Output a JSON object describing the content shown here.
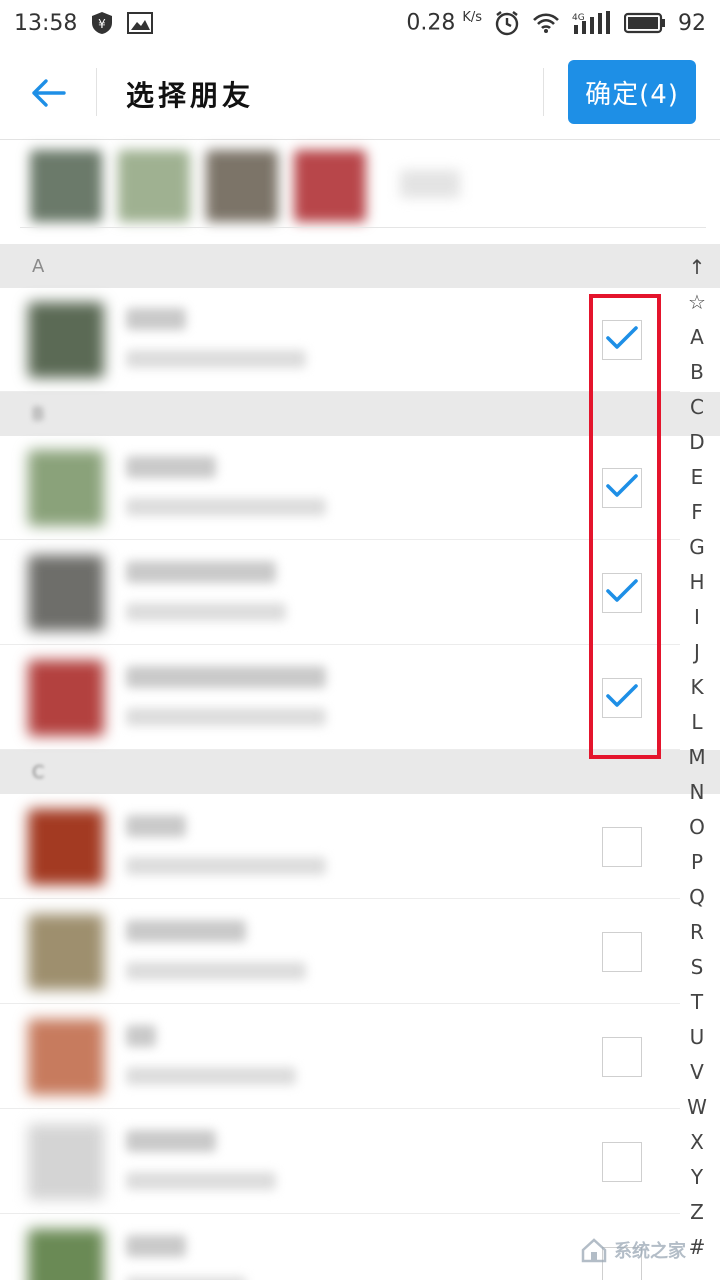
{
  "status_bar": {
    "time": "13:58",
    "speed": "0.28",
    "speed_unit": "K/s",
    "network": "4G",
    "battery": "92"
  },
  "header": {
    "title": "选择朋友",
    "confirm_label": "确定(4)"
  },
  "sections": [
    {
      "letter": "A"
    },
    {
      "letter": "B"
    },
    {
      "letter": "C"
    }
  ],
  "contacts": [
    {
      "section": "A",
      "checked": true,
      "avatar_color": "#5b6a55"
    },
    {
      "section": "B",
      "checked": true,
      "avatar_color": "#8aa27a"
    },
    {
      "section": "B",
      "checked": true,
      "avatar_color": "#6e6e6a"
    },
    {
      "section": "B",
      "checked": true,
      "avatar_color": "#b3413f"
    },
    {
      "section": "C",
      "checked": false,
      "avatar_color": "#a33a22"
    },
    {
      "section": "C",
      "checked": false,
      "avatar_color": "#9e8f6e"
    },
    {
      "section": "C",
      "checked": false,
      "avatar_color": "#c77b5e"
    },
    {
      "section": "C",
      "checked": false,
      "avatar_color": "#d4d4d4"
    },
    {
      "section": "C",
      "checked": false,
      "avatar_color": "#6a8a55"
    }
  ],
  "index_bar": [
    "↑",
    "☆",
    "A",
    "B",
    "C",
    "D",
    "E",
    "F",
    "G",
    "H",
    "I",
    "J",
    "K",
    "L",
    "M",
    "N",
    "O",
    "P",
    "Q",
    "R",
    "S",
    "T",
    "U",
    "V",
    "W",
    "X",
    "Y",
    "Z",
    "#"
  ],
  "watermark": {
    "text": "系统之家"
  },
  "colors": {
    "accent": "#1e8fe6",
    "highlight": "#e4142c",
    "section_bg": "#e9e9e9"
  }
}
